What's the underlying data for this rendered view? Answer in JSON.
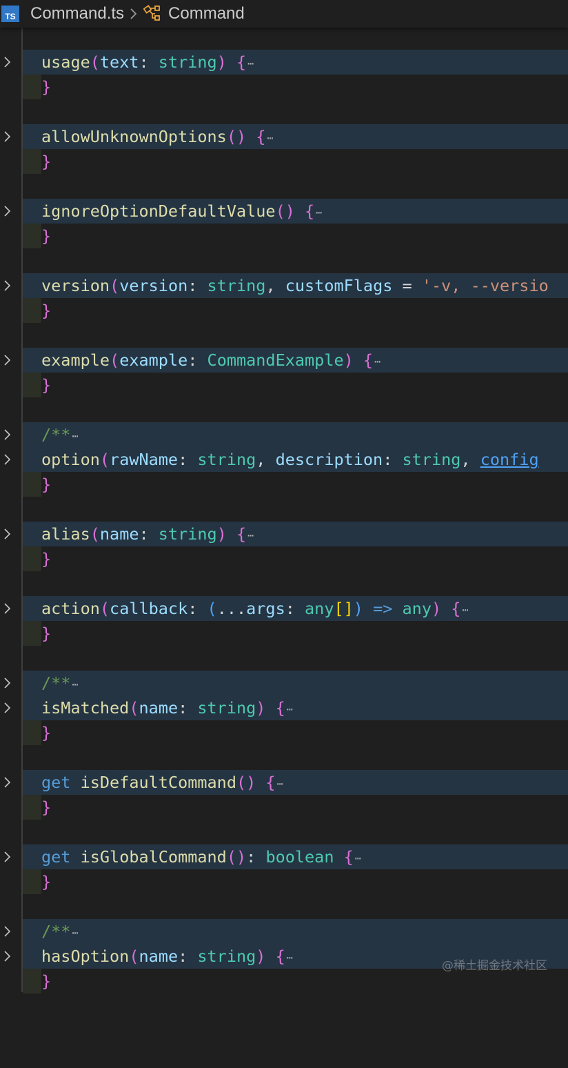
{
  "breadcrumb": {
    "file_icon_label": "TS",
    "file_name": "Command.ts",
    "separator_icon": "chevron-right-icon",
    "class_icon": "class-symbol-icon",
    "class_name": "Command"
  },
  "colors": {
    "function": "#dcdcaa",
    "parameter": "#9cdcfe",
    "type": "#4ec9b0",
    "keyword": "#569cd6",
    "string": "#ce9178",
    "comment": "#6a9955",
    "bracket": "#da70d6",
    "line_highlight": "#253443"
  },
  "editor": {
    "fold_icon": "chevron-right-icon",
    "folded_ellipsis": "⋯",
    "methods": {
      "usage": {
        "name": "usage",
        "open": "(",
        "p1": "text",
        "c1": ": ",
        "t1": "string",
        "close": ")",
        "brace": " {"
      },
      "allowUnknownOptions": {
        "name": "allowUnknownOptions",
        "parens": "()",
        "brace": " {"
      },
      "ignoreOptionDefaultValue": {
        "name": "ignoreOptionDefaultValue",
        "parens": "()",
        "brace": " {"
      },
      "version": {
        "name": "version",
        "open": "(",
        "p1": "version",
        "c1": ": ",
        "t1": "string",
        "comma": ", ",
        "p2": "customFlags",
        "eq": " = ",
        "str": "'-v, --versio"
      },
      "example": {
        "name": "example",
        "open": "(",
        "p1": "example",
        "c1": ": ",
        "t1": "CommandExample",
        "close": ")",
        "brace": " {"
      },
      "option": {
        "comment": "/**",
        "name": "option",
        "open": "(",
        "p1": "rawName",
        "c1": ": ",
        "t1": "string",
        "comma": ", ",
        "p2": "description",
        "c2": ": ",
        "t2": "string",
        "comma2": ", ",
        "p3": "config"
      },
      "alias": {
        "name": "alias",
        "open": "(",
        "p1": "name",
        "c1": ": ",
        "t1": "string",
        "close": ")",
        "brace": " {"
      },
      "action": {
        "name": "action",
        "open": "(",
        "p1": "callback",
        "c1": ": ",
        "po": "(",
        "spread": "...",
        "p2": "args",
        "c2": ": ",
        "t1": "any",
        "arr": "[]",
        "pc": ")",
        "arrow": " => ",
        "t2": "any",
        "close": ")",
        "brace": " {"
      },
      "isMatched": {
        "comment": "/**",
        "name": "isMatched",
        "open": "(",
        "p1": "name",
        "c1": ": ",
        "t1": "string",
        "close": ")",
        "brace": " {"
      },
      "isDefaultCommand": {
        "kw": "get",
        "name": "isDefaultCommand",
        "parens": "()",
        "brace": " {"
      },
      "isGlobalCommand": {
        "kw": "get",
        "name": "isGlobalCommand",
        "parens": "()",
        "c1": ": ",
        "t1": "boolean",
        "brace": " {"
      },
      "hasOption": {
        "comment": "/**",
        "name": "hasOption",
        "open": "(",
        "p1": "name",
        "c1": ": ",
        "t1": "string",
        "close": ")",
        "brace": " {"
      }
    },
    "closing_brace": "}"
  },
  "watermark": "@稀土掘金技术社区"
}
